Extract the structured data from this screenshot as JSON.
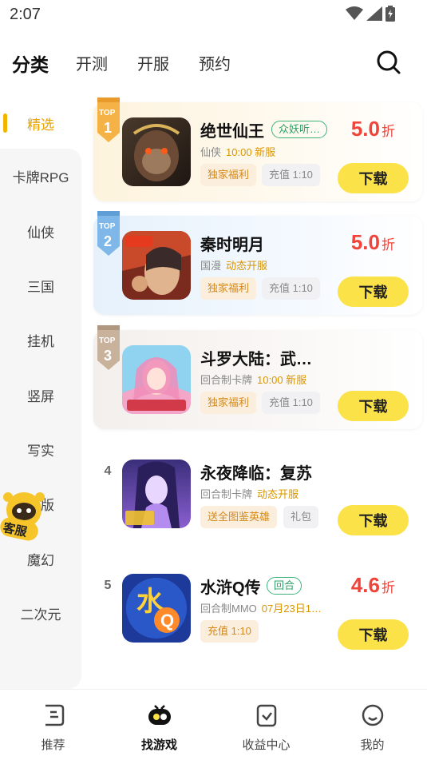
{
  "status_bar": {
    "time": "2:07"
  },
  "top_nav": {
    "tabs": [
      {
        "label": "分类",
        "active": true
      },
      {
        "label": "开测",
        "active": false
      },
      {
        "label": "开服",
        "active": false
      },
      {
        "label": "预约",
        "active": false
      }
    ]
  },
  "sidebar": {
    "items": [
      {
        "label": "精选",
        "active": true
      },
      {
        "label": "卡牌RPG"
      },
      {
        "label": "仙侠"
      },
      {
        "label": "三国"
      },
      {
        "label": "挂机"
      },
      {
        "label": "竖屏"
      },
      {
        "label": "写实"
      },
      {
        "label": "版"
      },
      {
        "label": "魔幻"
      },
      {
        "label": "二次元"
      }
    ]
  },
  "floating_service": {
    "label": "客服"
  },
  "games": [
    {
      "rank_label": "TOP",
      "rank": "1",
      "title": "绝世仙王",
      "tag": "众妖听…",
      "genre": "仙侠",
      "meta_accent": "10:00 新服",
      "chips": [
        "独家福利",
        "充值 1:10"
      ],
      "discount": "5.0",
      "discount_unit": "折",
      "button": "下载"
    },
    {
      "rank_label": "TOP",
      "rank": "2",
      "title": "秦时明月",
      "tag": "",
      "genre": "国漫",
      "meta_accent": "动态开服",
      "chips": [
        "独家福利",
        "充值 1:10"
      ],
      "discount": "5.0",
      "discount_unit": "折",
      "button": "下载"
    },
    {
      "rank_label": "TOP",
      "rank": "3",
      "title": "斗罗大陆：武…",
      "tag": "",
      "genre": "回合制卡牌",
      "meta_accent": "10:00 新服",
      "chips": [
        "独家福利",
        "充值 1:10"
      ],
      "discount": "",
      "discount_unit": "",
      "button": "下载"
    },
    {
      "rank_label": "",
      "rank": "4",
      "title": "永夜降临：复苏",
      "tag": "",
      "genre": "回合制卡牌",
      "meta_accent": "动态开服",
      "chips": [
        "送全图鉴英雄",
        "礼包"
      ],
      "discount": "",
      "discount_unit": "",
      "button": "下载"
    },
    {
      "rank_label": "",
      "rank": "5",
      "title": "水浒Q传",
      "tag": "回合",
      "genre": "回合制MMO",
      "meta_accent": "07月23日1…",
      "chips": [
        "充值 1:10"
      ],
      "discount": "4.6",
      "discount_unit": "折",
      "button": "下载"
    }
  ],
  "bottom_nav": {
    "items": [
      {
        "label": "推荐",
        "icon": "recommend-icon",
        "active": false
      },
      {
        "label": "找游戏",
        "icon": "find-game-icon",
        "active": true
      },
      {
        "label": "收益中心",
        "icon": "earnings-icon",
        "active": false
      },
      {
        "label": "我的",
        "icon": "profile-icon",
        "active": false
      }
    ]
  },
  "colors": {
    "accent_yellow": "#fbe248",
    "discount_red": "#f0443a",
    "active_orange": "#e8a300"
  }
}
